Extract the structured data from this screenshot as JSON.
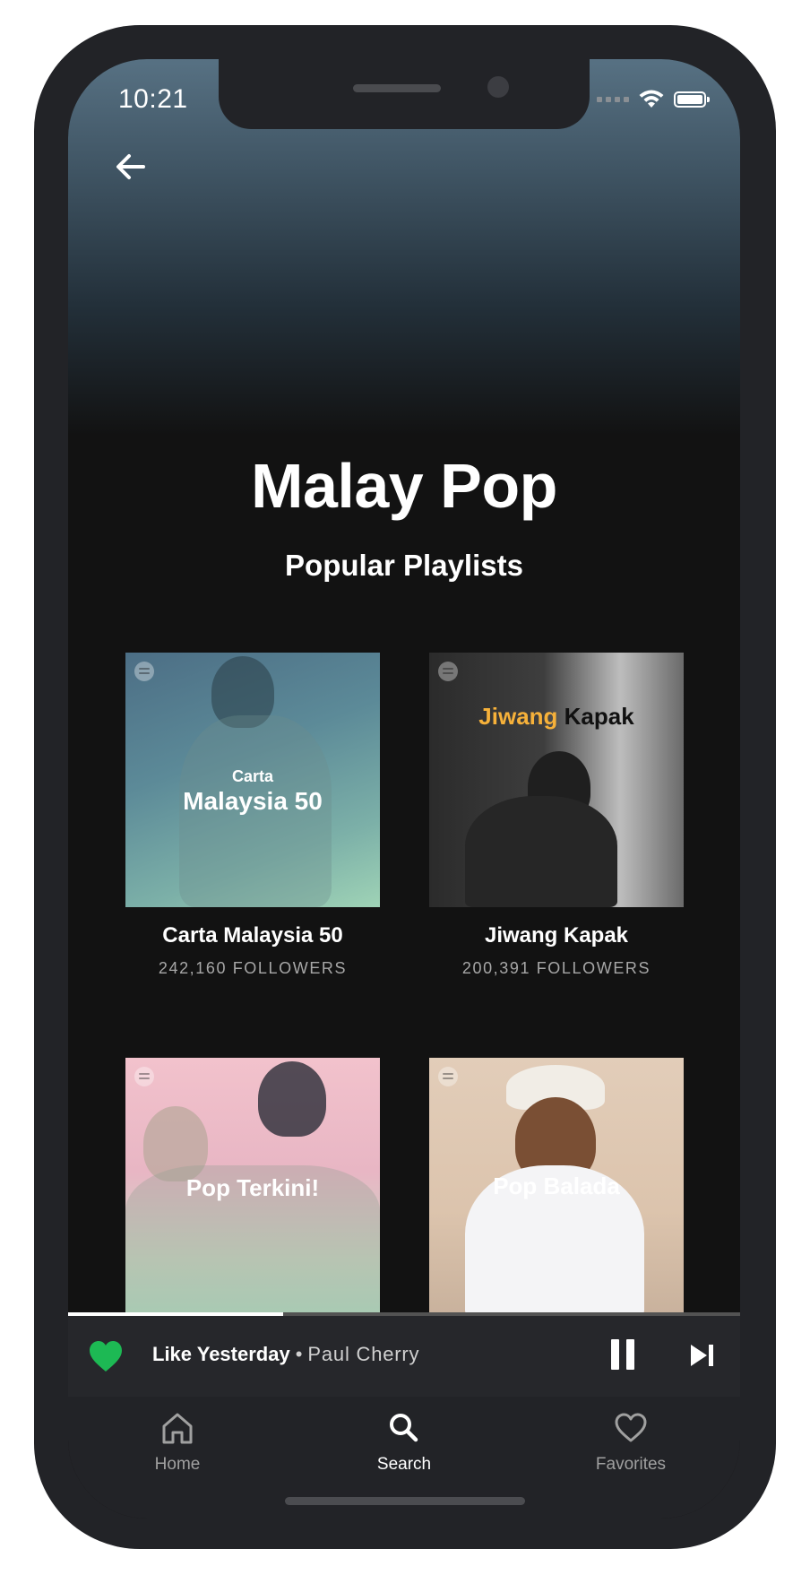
{
  "status_bar": {
    "time": "10:21"
  },
  "header": {
    "back_icon": "arrow-left-icon"
  },
  "page": {
    "title": "Malay Pop",
    "subtitle": "Popular Playlists"
  },
  "playlists": [
    {
      "name": "Carta Malaysia 50",
      "followers": "242,160 FOLLOWERS",
      "cover_line1": "Carta",
      "cover_line2": "Malaysia 50"
    },
    {
      "name": "Jiwang Kapak",
      "followers": "200,391 FOLLOWERS",
      "cover_word1": "Jiwang",
      "cover_word2": "Kapak",
      "accent": "#f6b13a"
    },
    {
      "name": "Pop Terkini!",
      "cover_title": "Pop Terkini!"
    },
    {
      "name": "Pop Balada",
      "cover_title": "Pop Balada"
    }
  ],
  "player": {
    "title": "Like Yesterday",
    "separator": "•",
    "artist": "Paul Cherry",
    "progress": 0.32,
    "liked_color": "#1db954"
  },
  "tabs": [
    {
      "label": "Home",
      "icon": "home-icon",
      "active": false
    },
    {
      "label": "Search",
      "icon": "search-icon",
      "active": true
    },
    {
      "label": "Favorites",
      "icon": "heart-outline-icon",
      "active": false
    }
  ]
}
